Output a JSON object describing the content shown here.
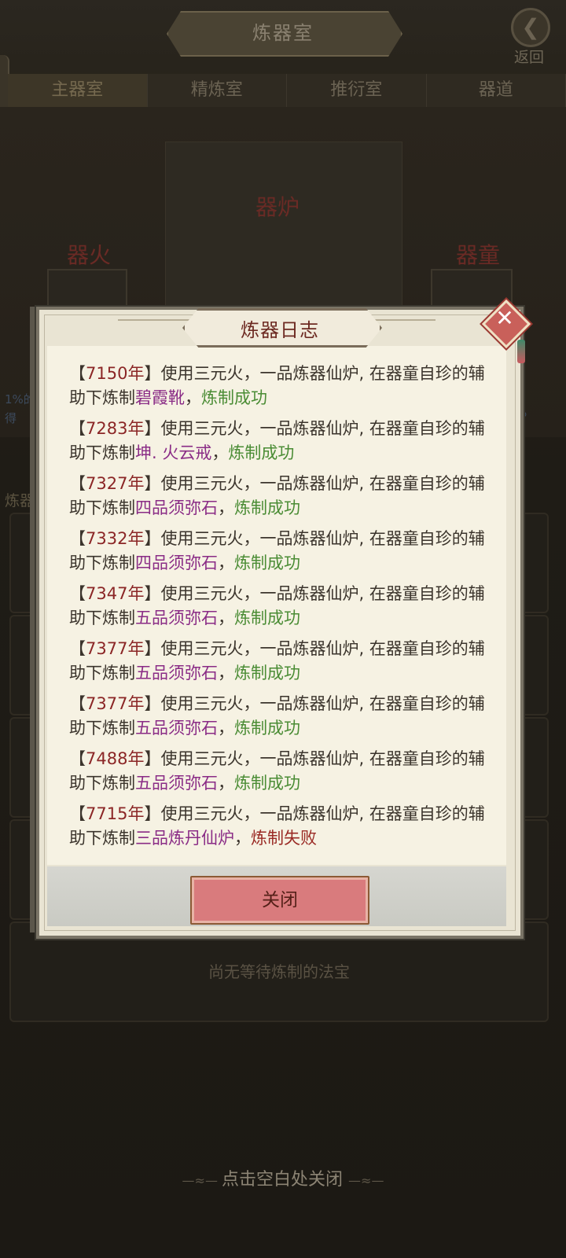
{
  "header": {
    "title": "炼器室",
    "back_label": "返回"
  },
  "tabs": [
    "主器室",
    "精炼室",
    "推衍室",
    "器道"
  ],
  "scene": {
    "furnace_label": "器炉",
    "fire_label": "器火",
    "boy_label": "器童",
    "side_left": "1%的",
    "side_left2": "得",
    "side_right": "%",
    "side_left3": "炼器"
  },
  "queue": {
    "empty_text": "尚无等待炼制的法宝"
  },
  "hint": "点击空白处关闭",
  "dialog": {
    "title": "炼器日志",
    "close_button": "关闭",
    "entries": [
      {
        "year": "7150年",
        "text": "使用三元火，一品炼器仙炉, 在器童自珍的辅助下炼制",
        "item": "碧霞靴",
        "result": "炼制成功",
        "status": "ok"
      },
      {
        "year": "7283年",
        "text": "使用三元火，一品炼器仙炉, 在器童自珍的辅助下炼制",
        "item": "坤. 火云戒",
        "result": "炼制成功",
        "status": "ok"
      },
      {
        "year": "7327年",
        "text": "使用三元火，一品炼器仙炉, 在器童自珍的辅助下炼制",
        "item": "四品须弥石",
        "result": "炼制成功",
        "status": "ok"
      },
      {
        "year": "7332年",
        "text": "使用三元火，一品炼器仙炉, 在器童自珍的辅助下炼制",
        "item": "四品须弥石",
        "result": "炼制成功",
        "status": "ok"
      },
      {
        "year": "7347年",
        "text": "使用三元火，一品炼器仙炉, 在器童自珍的辅助下炼制",
        "item": "五品须弥石",
        "result": "炼制成功",
        "status": "ok"
      },
      {
        "year": "7377年",
        "text": "使用三元火，一品炼器仙炉, 在器童自珍的辅助下炼制",
        "item": "五品须弥石",
        "result": "炼制成功",
        "status": "ok"
      },
      {
        "year": "7377年",
        "text": "使用三元火，一品炼器仙炉, 在器童自珍的辅助下炼制",
        "item": "五品须弥石",
        "result": "炼制成功",
        "status": "ok"
      },
      {
        "year": "7488年",
        "text": "使用三元火，一品炼器仙炉, 在器童自珍的辅助下炼制",
        "item": "五品须弥石",
        "result": "炼制成功",
        "status": "ok"
      },
      {
        "year": "7715年",
        "text": "使用三元火，一品炼器仙炉, 在器童自珍的辅助下炼制",
        "item": "三品炼丹仙炉",
        "result": "炼制失败",
        "status": "fail"
      }
    ]
  },
  "colors": {
    "year": "#8b2626",
    "item": "#8a2c86",
    "success": "#4a8c34",
    "fail": "#9a2a24",
    "button": "#d97b7d"
  }
}
